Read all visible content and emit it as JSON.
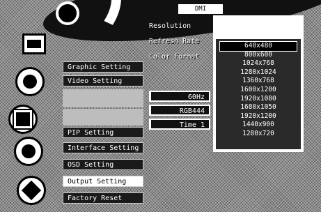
{
  "title_tab": "DMI",
  "fields": {
    "resolution_label": "Resolution",
    "refresh_rate_label": "Refresh Rate",
    "color_format_label": "Color Format"
  },
  "menu": {
    "items": [
      {
        "label": "Graphic Setting",
        "highlight": false
      },
      {
        "label": "Video Setting",
        "highlight": false
      },
      {
        "label": "",
        "highlight": true
      },
      {
        "label": "",
        "highlight": true
      },
      {
        "label": "PIP Setting",
        "highlight": false
      },
      {
        "label": "Interface Setting",
        "highlight": false
      },
      {
        "label": "OSD Setting",
        "highlight": false
      },
      {
        "label": "Output Setting",
        "highlight": true
      },
      {
        "label": "Factory Reset",
        "highlight": false
      }
    ]
  },
  "values": {
    "refresh": "60Hz",
    "color": "RGB444",
    "extra": "Time 1"
  },
  "dropdown": {
    "selected_index": 0,
    "options": [
      "640x480",
      "800x600",
      "1024x768",
      "1280x1024",
      "1360x768",
      "1600x1200",
      "1920x1080",
      "1680x1050",
      "1920x1200",
      "1440x900",
      "1280x720"
    ]
  }
}
